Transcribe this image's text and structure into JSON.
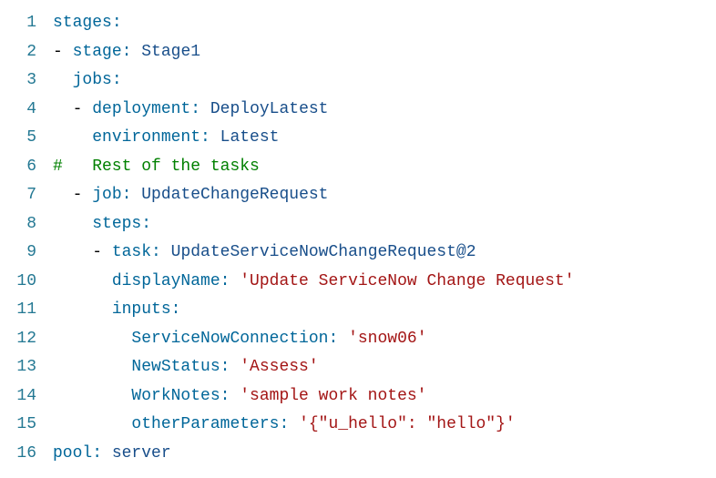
{
  "lines": [
    {
      "num": "1",
      "content": [
        {
          "t": "key",
          "v": "stages"
        },
        {
          "t": "key",
          "v": ":"
        }
      ]
    },
    {
      "num": "2",
      "content": [
        {
          "t": "dash",
          "v": "- "
        },
        {
          "t": "key",
          "v": "stage"
        },
        {
          "t": "key",
          "v": ": "
        },
        {
          "t": "value",
          "v": "Stage1"
        }
      ]
    },
    {
      "num": "3",
      "content": [
        {
          "t": "guide",
          "v": "| "
        },
        {
          "t": "key",
          "v": "jobs"
        },
        {
          "t": "key",
          "v": ":"
        }
      ]
    },
    {
      "num": "4",
      "content": [
        {
          "t": "guide",
          "v": "| "
        },
        {
          "t": "dash",
          "v": "- "
        },
        {
          "t": "key",
          "v": "deployment"
        },
        {
          "t": "key",
          "v": ": "
        },
        {
          "t": "value",
          "v": "DeployLatest"
        }
      ]
    },
    {
      "num": "5",
      "content": [
        {
          "t": "guide",
          "v": "| | "
        },
        {
          "t": "key",
          "v": "environment"
        },
        {
          "t": "key",
          "v": ": "
        },
        {
          "t": "value",
          "v": "Latest"
        }
      ]
    },
    {
      "num": "6",
      "content": [
        {
          "t": "comment",
          "v": "#   Rest of the tasks"
        }
      ]
    },
    {
      "num": "7",
      "content": [
        {
          "t": "guide",
          "v": "| "
        },
        {
          "t": "dash",
          "v": "- "
        },
        {
          "t": "key",
          "v": "job"
        },
        {
          "t": "key",
          "v": ": "
        },
        {
          "t": "value",
          "v": "UpdateChangeRequest"
        }
      ]
    },
    {
      "num": "8",
      "content": [
        {
          "t": "guide",
          "v": "| | "
        },
        {
          "t": "key",
          "v": "steps"
        },
        {
          "t": "key",
          "v": ":"
        }
      ]
    },
    {
      "num": "9",
      "content": [
        {
          "t": "guide",
          "v": "| | "
        },
        {
          "t": "dash",
          "v": "- "
        },
        {
          "t": "key",
          "v": "task"
        },
        {
          "t": "key",
          "v": ": "
        },
        {
          "t": "value",
          "v": "UpdateServiceNowChangeRequest@2"
        }
      ]
    },
    {
      "num": "10",
      "content": [
        {
          "t": "guide",
          "v": "| | | "
        },
        {
          "t": "key",
          "v": "displayName"
        },
        {
          "t": "key",
          "v": ": "
        },
        {
          "t": "string",
          "v": "'Update ServiceNow Change Request'"
        }
      ]
    },
    {
      "num": "11",
      "content": [
        {
          "t": "guide",
          "v": "| | | "
        },
        {
          "t": "key",
          "v": "inputs"
        },
        {
          "t": "key",
          "v": ":"
        }
      ]
    },
    {
      "num": "12",
      "content": [
        {
          "t": "guide",
          "v": "| | | | "
        },
        {
          "t": "key",
          "v": "ServiceNowConnection"
        },
        {
          "t": "key",
          "v": ": "
        },
        {
          "t": "string",
          "v": "'snow06'"
        }
      ]
    },
    {
      "num": "13",
      "content": [
        {
          "t": "guide",
          "v": "| | | | "
        },
        {
          "t": "key",
          "v": "NewStatus"
        },
        {
          "t": "key",
          "v": ": "
        },
        {
          "t": "string",
          "v": "'Assess'"
        }
      ]
    },
    {
      "num": "14",
      "content": [
        {
          "t": "guide",
          "v": "| | | | "
        },
        {
          "t": "key",
          "v": "WorkNotes"
        },
        {
          "t": "key",
          "v": ": "
        },
        {
          "t": "string",
          "v": "'sample work notes'"
        }
      ]
    },
    {
      "num": "15",
      "content": [
        {
          "t": "guide",
          "v": "| | | | "
        },
        {
          "t": "key",
          "v": "otherParameters"
        },
        {
          "t": "key",
          "v": ": "
        },
        {
          "t": "string",
          "v": "'{\"u_hello\": \"hello\"}'"
        }
      ]
    },
    {
      "num": "16",
      "content": [
        {
          "t": "key",
          "v": "pool"
        },
        {
          "t": "key",
          "v": ": "
        },
        {
          "t": "value",
          "v": "server"
        }
      ]
    }
  ]
}
